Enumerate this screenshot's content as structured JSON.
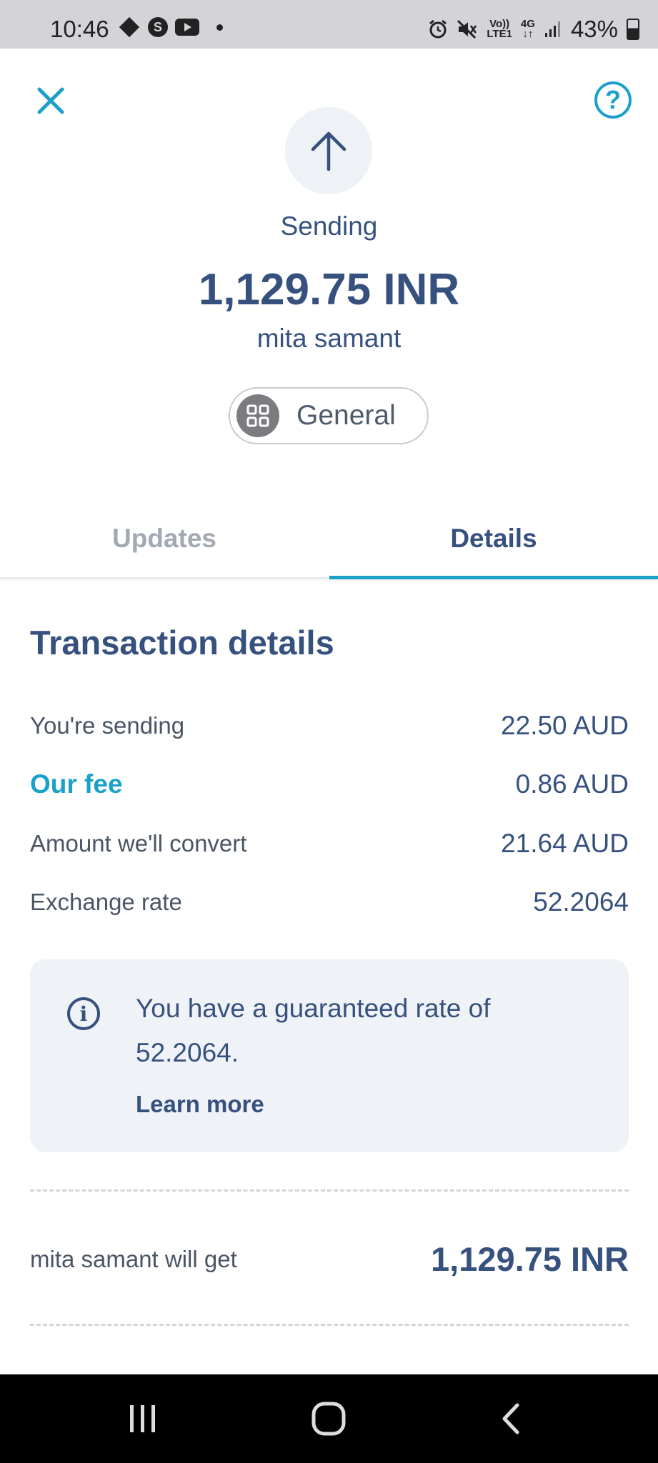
{
  "status_bar": {
    "time": "10:46",
    "network_top": "Vo))",
    "network_bottom": "LTE1",
    "signal_type": "4G",
    "battery": "43%"
  },
  "header": {
    "status": "Sending",
    "amount": "1,129.75 INR",
    "recipient": "mita samant",
    "category": "General"
  },
  "tabs": [
    {
      "label": "Updates",
      "active": false
    },
    {
      "label": "Details",
      "active": true
    }
  ],
  "details": {
    "title": "Transaction details",
    "rows": [
      {
        "label": "You're sending",
        "value": "22.50 AUD"
      },
      {
        "label": "Our fee",
        "value": "0.86 AUD"
      },
      {
        "label": "Amount we'll convert",
        "value": "21.64 AUD"
      },
      {
        "label": "Exchange rate",
        "value": "52.2064"
      }
    ],
    "info": {
      "text": "You have a guaranteed rate of 52.2064.",
      "link": "Learn more"
    },
    "receive_label": "mita samant will get",
    "receive_value": "1,129.75 INR"
  },
  "colors": {
    "primary_text": "#37517e",
    "accent": "#1ba0c9",
    "info_bg": "#eff2f6"
  },
  "icons": {
    "close": "close-icon",
    "help": "question-mark-icon",
    "arrow": "arrow-up-icon",
    "category": "grid-icon",
    "info": "info-icon"
  }
}
